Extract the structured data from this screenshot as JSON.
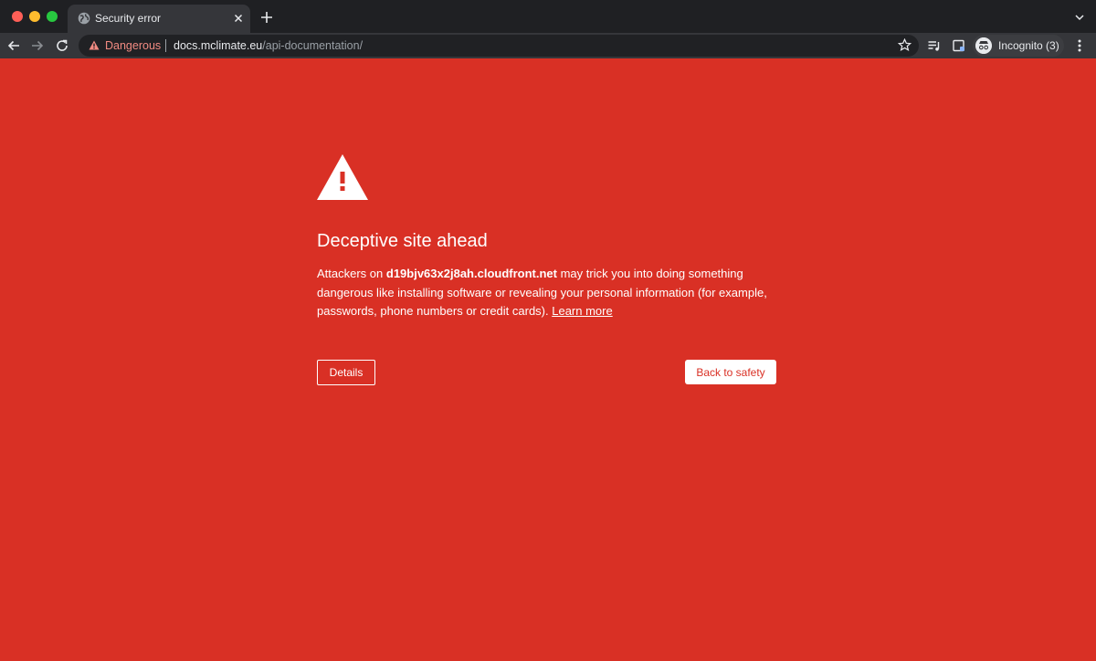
{
  "tab": {
    "title": "Security error",
    "favicon": "globe-icon"
  },
  "omnibox": {
    "security_label": "Dangerous",
    "url_host": "docs.mclimate.eu",
    "url_path": "/api-documentation/"
  },
  "profile": {
    "label": "Incognito (3)"
  },
  "interstitial": {
    "heading": "Deceptive site ahead",
    "body_prefix": "Attackers on ",
    "host": "d19bjv63x2j8ah.cloudfront.net",
    "body_suffix": " may trick you into doing something dangerous like installing software or revealing your personal information (for example, passwords, phone numbers or credit cards). ",
    "learn_more": "Learn more",
    "details_button": "Details",
    "back_button": "Back to safety"
  },
  "colors": {
    "background": "#d93025",
    "danger_text": "#f28b82",
    "chrome_dark": "#1f2023",
    "toolbar": "#35363a"
  }
}
